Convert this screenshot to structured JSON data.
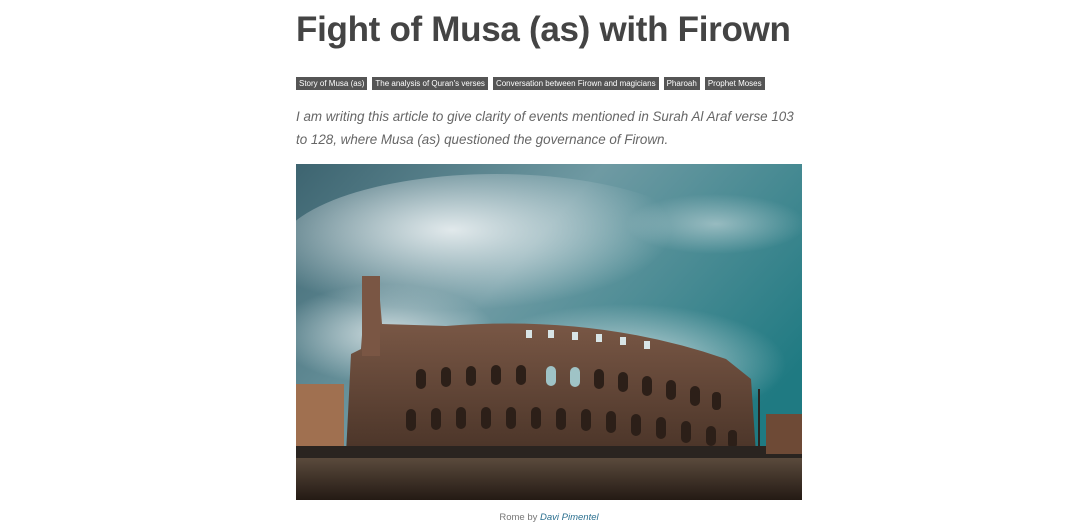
{
  "article": {
    "title": "Fight of Musa (as) with Firown",
    "tags": [
      "Story of Musa (as)",
      "The analysis of Quran's verses",
      "Conversation between Firown and magicians",
      "Pharoah",
      "Prophet Moses"
    ],
    "intro": "I am writing this article to give clarity of events mentioned in Surah Al Araf verse 103 to 128, where Musa (as) questioned the governance of Firown."
  },
  "figure": {
    "alt": "Colosseum under a cloudy teal sky",
    "caption_prefix": "Rome by",
    "caption_author": "Davi Pimentel"
  },
  "colors": {
    "title": "#444444",
    "tag_bg": "#555555",
    "link": "#2a6f8f"
  }
}
